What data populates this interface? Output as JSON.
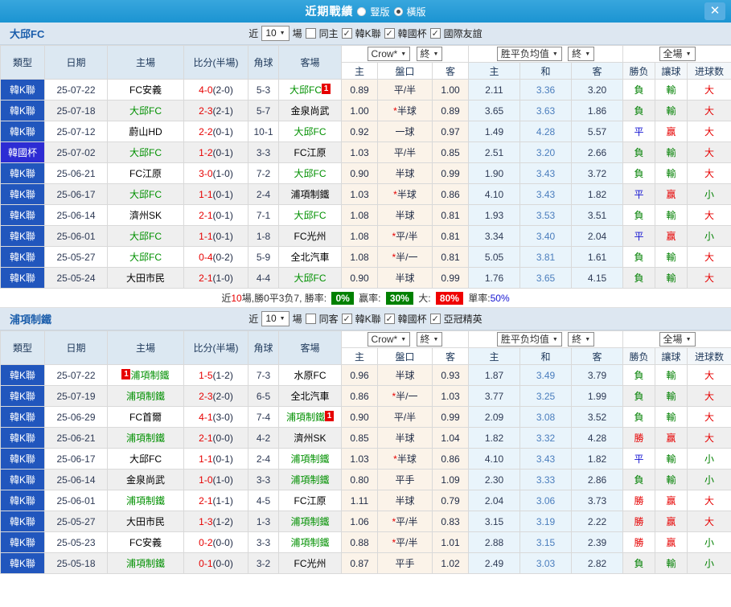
{
  "titlebar": {
    "title": "近期戰績",
    "layout_options": [
      "豎版",
      "橫版"
    ],
    "selected_layout": "橫版"
  },
  "icons": {
    "close": "✕",
    "dropdown_arrow": "▼",
    "checkmark": "✓"
  },
  "colors": {
    "titlebar": "#1b94d2",
    "type_league_bg": "#2156bd",
    "type_cup_bg": "#2d2cd4",
    "highlight_team": "#009000",
    "score_red": "#e60000",
    "win_red": "#e60000",
    "loss_green": "#008000",
    "draw_blue": "#1414d2",
    "odds_bg": "#fbf3e9",
    "avg_bg": "#e9f4fb"
  },
  "table_header": {
    "type": "類型",
    "date": "日期",
    "home": "主場",
    "score": "比分(半場)",
    "corners": "角球",
    "away": "客場",
    "bookmaker": "Crow*",
    "final1": "終",
    "avg_select": "胜平负均值",
    "final2": "終",
    "full_select": "全場",
    "sub_home": "主",
    "sub_handicap": "盤口",
    "sub_away": "客",
    "sub_avg_home": "主",
    "sub_avg_draw": "和",
    "sub_avg_away": "客",
    "sub_result": "勝负",
    "sub_handicap_result": "讓球",
    "sub_goals": "进球数"
  },
  "result_colors": {
    "勝": "red",
    "平": "blue",
    "負": "green",
    "赢": "red",
    "輸": "green",
    "大": "red",
    "小": "green"
  },
  "sections": [
    {
      "team": "大邱FC",
      "filters": {
        "near_label": "近",
        "count": "10",
        "games_label": "場",
        "same_label": "同主",
        "same_checked": false,
        "leagues": [
          "韓K聯",
          "韓國杯",
          "國際友誼"
        ]
      },
      "summary": {
        "pre": "近",
        "n": "10",
        "rest": "場,勝0平3负7, 勝率:",
        "win_rate": "0%",
        "asian_label": "赢率:",
        "asian_rate": "30%",
        "ou_label": "大:",
        "ou_rate": "80%",
        "odd_label": "單率:",
        "odd_rate": "50%"
      },
      "rows": [
        {
          "type": "韓K聯",
          "date": "25-07-22",
          "home": {
            "name": "FC安義"
          },
          "away": {
            "name": "大邱FC",
            "hl": true,
            "badge": "post"
          },
          "score": "4-0",
          "half": "(2-0)",
          "corners": "5-3",
          "o1": "0.89",
          "hcp": "平/半",
          "o2": "1.00",
          "a1": "2.11",
          "ax": "3.36",
          "a2": "3.20",
          "r1": "負",
          "r2": "輸",
          "r3": "大"
        },
        {
          "type": "韓K聯",
          "date": "25-07-18",
          "home": {
            "name": "大邱FC",
            "hl": true
          },
          "away": {
            "name": "金泉尚武"
          },
          "score": "2-3",
          "half": "(2-1)",
          "corners": "5-7",
          "o1": "1.00",
          "star": true,
          "hcp": "半球",
          "o2": "0.89",
          "a1": "3.65",
          "ax": "3.63",
          "a2": "1.86",
          "r1": "負",
          "r2": "輸",
          "r3": "大"
        },
        {
          "type": "韓K聯",
          "date": "25-07-12",
          "home": {
            "name": "蔚山HD"
          },
          "away": {
            "name": "大邱FC",
            "hl": true
          },
          "score": "2-2",
          "half": "(0-1)",
          "corners": "10-1",
          "o1": "0.92",
          "hcp": "一球",
          "o2": "0.97",
          "a1": "1.49",
          "ax": "4.28",
          "a2": "5.57",
          "r1": "平",
          "r2": "赢",
          "r3": "大"
        },
        {
          "type": "韓國杯",
          "cup": true,
          "date": "25-07-02",
          "home": {
            "name": "大邱FC",
            "hl": true
          },
          "away": {
            "name": "FC江原"
          },
          "score": "1-2",
          "half": "(0-1)",
          "corners": "3-3",
          "o1": "1.03",
          "hcp": "平/半",
          "o2": "0.85",
          "a1": "2.51",
          "ax": "3.20",
          "a2": "2.66",
          "r1": "負",
          "r2": "輸",
          "r3": "大"
        },
        {
          "type": "韓K聯",
          "date": "25-06-21",
          "home": {
            "name": "FC江原"
          },
          "away": {
            "name": "大邱FC",
            "hl": true
          },
          "score": "3-0",
          "half": "(1-0)",
          "corners": "7-2",
          "o1": "0.90",
          "hcp": "半球",
          "o2": "0.99",
          "a1": "1.90",
          "ax": "3.43",
          "a2": "3.72",
          "r1": "負",
          "r2": "輸",
          "r3": "大"
        },
        {
          "type": "韓K聯",
          "date": "25-06-17",
          "home": {
            "name": "大邱FC",
            "hl": true
          },
          "away": {
            "name": "浦項制鐵"
          },
          "score": "1-1",
          "half": "(0-1)",
          "corners": "2-4",
          "o1": "1.03",
          "star": true,
          "hcp": "半球",
          "o2": "0.86",
          "a1": "4.10",
          "ax": "3.43",
          "a2": "1.82",
          "r1": "平",
          "r2": "赢",
          "r3": "小"
        },
        {
          "type": "韓K聯",
          "date": "25-06-14",
          "home": {
            "name": "濟州SK"
          },
          "away": {
            "name": "大邱FC",
            "hl": true
          },
          "score": "2-1",
          "half": "(0-1)",
          "corners": "7-1",
          "o1": "1.08",
          "hcp": "半球",
          "o2": "0.81",
          "a1": "1.93",
          "ax": "3.53",
          "a2": "3.51",
          "r1": "負",
          "r2": "輸",
          "r3": "大"
        },
        {
          "type": "韓K聯",
          "date": "25-06-01",
          "home": {
            "name": "大邱FC",
            "hl": true
          },
          "away": {
            "name": "FC光州"
          },
          "score": "1-1",
          "half": "(0-1)",
          "corners": "1-8",
          "o1": "1.08",
          "star": true,
          "hcp": "平/半",
          "o2": "0.81",
          "a1": "3.34",
          "ax": "3.40",
          "a2": "2.04",
          "r1": "平",
          "r2": "赢",
          "r3": "小"
        },
        {
          "type": "韓K聯",
          "date": "25-05-27",
          "home": {
            "name": "大邱FC",
            "hl": true
          },
          "away": {
            "name": "全北汽車"
          },
          "score": "0-4",
          "half": "(0-2)",
          "corners": "5-9",
          "o1": "1.08",
          "star": true,
          "hcp": "半/一",
          "o2": "0.81",
          "a1": "5.05",
          "ax": "3.81",
          "a2": "1.61",
          "r1": "負",
          "r2": "輸",
          "r3": "大"
        },
        {
          "type": "韓K聯",
          "date": "25-05-24",
          "home": {
            "name": "大田市民"
          },
          "away": {
            "name": "大邱FC",
            "hl": true
          },
          "score": "2-1",
          "half": "(1-0)",
          "corners": "4-4",
          "o1": "0.90",
          "hcp": "半球",
          "o2": "0.99",
          "a1": "1.76",
          "ax": "3.65",
          "a2": "4.15",
          "r1": "負",
          "r2": "輸",
          "r3": "大"
        }
      ]
    },
    {
      "team": "浦項制鐵",
      "filters": {
        "near_label": "近",
        "count": "10",
        "games_label": "場",
        "same_label": "同客",
        "same_checked": false,
        "leagues": [
          "韓K聯",
          "韓國杯",
          "亞冠精英"
        ]
      },
      "rows": [
        {
          "type": "韓K聯",
          "date": "25-07-22",
          "home": {
            "name": "浦項制鐵",
            "hl": true,
            "badge": "pre"
          },
          "away": {
            "name": "水原FC"
          },
          "score": "1-5",
          "half": "(1-2)",
          "corners": "7-3",
          "o1": "0.96",
          "hcp": "半球",
          "o2": "0.93",
          "a1": "1.87",
          "ax": "3.49",
          "a2": "3.79",
          "r1": "負",
          "r2": "輸",
          "r3": "大"
        },
        {
          "type": "韓K聯",
          "date": "25-07-19",
          "home": {
            "name": "浦項制鐵",
            "hl": true
          },
          "away": {
            "name": "全北汽車"
          },
          "score": "2-3",
          "half": "(2-0)",
          "corners": "6-5",
          "o1": "0.86",
          "star": true,
          "hcp": "半/一",
          "o2": "1.03",
          "a1": "3.77",
          "ax": "3.25",
          "a2": "1.99",
          "r1": "負",
          "r2": "輸",
          "r3": "大"
        },
        {
          "type": "韓K聯",
          "date": "25-06-29",
          "home": {
            "name": "FC首爾"
          },
          "away": {
            "name": "浦項制鐵",
            "hl": true,
            "badge": "post"
          },
          "score": "4-1",
          "half": "(3-0)",
          "corners": "7-4",
          "o1": "0.90",
          "hcp": "平/半",
          "o2": "0.99",
          "a1": "2.09",
          "ax": "3.08",
          "a2": "3.52",
          "r1": "負",
          "r2": "輸",
          "r3": "大"
        },
        {
          "type": "韓K聯",
          "date": "25-06-21",
          "home": {
            "name": "浦項制鐵",
            "hl": true
          },
          "away": {
            "name": "濟州SK"
          },
          "score": "2-1",
          "half": "(0-0)",
          "corners": "4-2",
          "o1": "0.85",
          "hcp": "半球",
          "o2": "1.04",
          "a1": "1.82",
          "ax": "3.32",
          "a2": "4.28",
          "r1": "勝",
          "r2": "赢",
          "r3": "大"
        },
        {
          "type": "韓K聯",
          "date": "25-06-17",
          "home": {
            "name": "大邱FC"
          },
          "away": {
            "name": "浦項制鐵",
            "hl": true
          },
          "score": "1-1",
          "half": "(0-1)",
          "corners": "2-4",
          "o1": "1.03",
          "star": true,
          "hcp": "半球",
          "o2": "0.86",
          "a1": "4.10",
          "ax": "3.43",
          "a2": "1.82",
          "r1": "平",
          "r2": "輸",
          "r3": "小"
        },
        {
          "type": "韓K聯",
          "date": "25-06-14",
          "home": {
            "name": "金泉尚武"
          },
          "away": {
            "name": "浦項制鐵",
            "hl": true
          },
          "score": "1-0",
          "half": "(1-0)",
          "corners": "3-3",
          "o1": "0.80",
          "hcp": "平手",
          "o2": "1.09",
          "a1": "2.30",
          "ax": "3.33",
          "a2": "2.86",
          "r1": "負",
          "r2": "輸",
          "r3": "小"
        },
        {
          "type": "韓K聯",
          "date": "25-06-01",
          "home": {
            "name": "浦項制鐵",
            "hl": true
          },
          "away": {
            "name": "FC江原"
          },
          "score": "2-1",
          "half": "(1-1)",
          "corners": "4-5",
          "o1": "1.11",
          "hcp": "半球",
          "o2": "0.79",
          "a1": "2.04",
          "ax": "3.06",
          "a2": "3.73",
          "r1": "勝",
          "r2": "赢",
          "r3": "大"
        },
        {
          "type": "韓K聯",
          "date": "25-05-27",
          "home": {
            "name": "大田市民"
          },
          "away": {
            "name": "浦項制鐵",
            "hl": true
          },
          "score": "1-3",
          "half": "(1-2)",
          "corners": "1-3",
          "o1": "1.06",
          "star": true,
          "hcp": "平/半",
          "o2": "0.83",
          "a1": "3.15",
          "ax": "3.19",
          "a2": "2.22",
          "r1": "勝",
          "r2": "赢",
          "r3": "大"
        },
        {
          "type": "韓K聯",
          "date": "25-05-23",
          "home": {
            "name": "FC安義"
          },
          "away": {
            "name": "浦項制鐵",
            "hl": true
          },
          "score": "0-2",
          "half": "(0-0)",
          "corners": "3-3",
          "o1": "0.88",
          "star": true,
          "hcp": "平/半",
          "o2": "1.01",
          "a1": "2.88",
          "ax": "3.15",
          "a2": "2.39",
          "r1": "勝",
          "r2": "赢",
          "r3": "小"
        },
        {
          "type": "韓K聯",
          "date": "25-05-18",
          "home": {
            "name": "浦項制鐵",
            "hl": true
          },
          "away": {
            "name": "FC光州"
          },
          "score": "0-1",
          "half": "(0-0)",
          "corners": "3-2",
          "o1": "0.87",
          "hcp": "平手",
          "o2": "1.02",
          "a1": "2.49",
          "ax": "3.03",
          "a2": "2.82",
          "r1": "負",
          "r2": "輸",
          "r3": "小"
        }
      ]
    }
  ]
}
